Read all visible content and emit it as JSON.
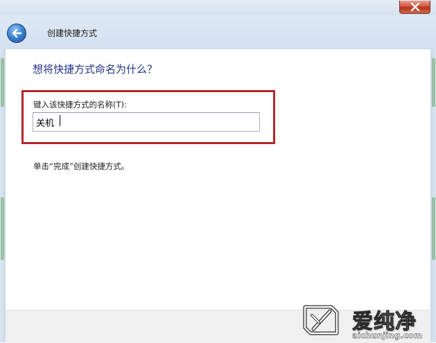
{
  "window": {
    "close_label": "✕"
  },
  "header": {
    "title": "创建快捷方式",
    "back_icon": "back-arrow-icon"
  },
  "main": {
    "heading": "想将快捷方式命名为什么？",
    "field_label": "键入该快捷方式的名称(T):",
    "name_value": "关机",
    "hint": "单击“完成”创建快捷方式。"
  },
  "watermark": {
    "brand": "爱纯净",
    "url": "aichunjing.com"
  },
  "colors": {
    "heading": "#1e3287",
    "highlight_outline": "#b3262b",
    "close_button": "#c8432b",
    "back_button": "#3f86d3"
  }
}
